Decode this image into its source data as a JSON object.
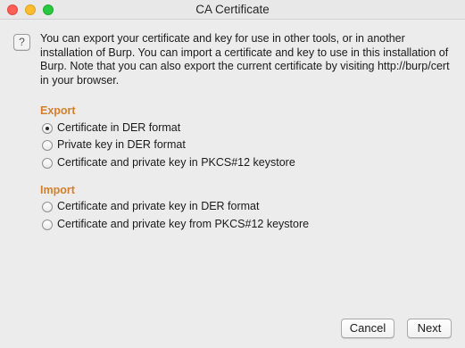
{
  "window": {
    "title": "CA Certificate"
  },
  "help_icon": {
    "glyph": "?",
    "name": "help-icon"
  },
  "description": "You can export your certificate and key for use in other tools, or in another\ninstallation of Burp. You can import a certificate and key to use in this installation of\nBurp. Note that you can also export the current certificate by visiting http://burp/cert\nin your browser.",
  "export": {
    "title": "Export",
    "options": [
      {
        "label": "Certificate in DER format",
        "selected": true
      },
      {
        "label": "Private key in DER format",
        "selected": false
      },
      {
        "label": "Certificate and private key in PKCS#12 keystore",
        "selected": false
      }
    ]
  },
  "import": {
    "title": "Import",
    "options": [
      {
        "label": "Certificate and private key in DER format",
        "selected": false
      },
      {
        "label": "Certificate and private key from PKCS#12 keystore",
        "selected": false
      }
    ]
  },
  "buttons": {
    "cancel": "Cancel",
    "next": "Next"
  },
  "colors": {
    "section_title": "#d4802a",
    "background": "#ececec",
    "traffic_close": "#fc5f57",
    "traffic_minimize": "#fdbc2e",
    "traffic_maximize": "#28c840"
  }
}
